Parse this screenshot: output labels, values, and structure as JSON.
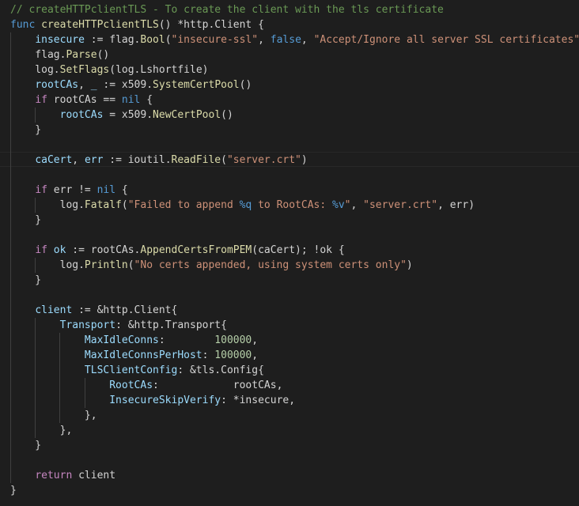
{
  "editor": {
    "theme_colors": {
      "background": "#1e1e1e",
      "comment": "#6a9955",
      "keyword": "#569cd6",
      "control": "#c586c0",
      "function": "#dcdcaa",
      "string": "#ce9178",
      "variable": "#9cdcfe",
      "number": "#b5cea8",
      "plain": "#d4d4d4"
    },
    "lines": [
      [
        [
          "com",
          "// createHTTPclientTLS - To create the client with the tls certificate"
        ]
      ],
      [
        [
          "kw",
          "func"
        ],
        [
          "pl",
          " "
        ],
        [
          "fn",
          "createHTTPclientTLS"
        ],
        [
          "pl",
          "() *http.Client {"
        ]
      ],
      [
        [
          "pl",
          "    "
        ],
        [
          "var",
          "insecure"
        ],
        [
          "pl",
          " := flag."
        ],
        [
          "fn",
          "Bool"
        ],
        [
          "pl",
          "("
        ],
        [
          "str",
          "\"insecure-ssl\""
        ],
        [
          "pl",
          ", "
        ],
        [
          "kw",
          "false"
        ],
        [
          "pl",
          ", "
        ],
        [
          "str",
          "\"Accept/Ignore all server SSL certificates\""
        ],
        [
          "pl",
          ")"
        ]
      ],
      [
        [
          "pl",
          "    flag."
        ],
        [
          "fn",
          "Parse"
        ],
        [
          "pl",
          "()"
        ]
      ],
      [
        [
          "pl",
          "    log."
        ],
        [
          "fn",
          "SetFlags"
        ],
        [
          "pl",
          "(log.Lshortfile)"
        ]
      ],
      [
        [
          "pl",
          "    "
        ],
        [
          "var",
          "rootCAs"
        ],
        [
          "pl",
          ", "
        ],
        [
          "var",
          "_"
        ],
        [
          "pl",
          " := x509."
        ],
        [
          "fn",
          "SystemCertPool"
        ],
        [
          "pl",
          "()"
        ]
      ],
      [
        [
          "pl",
          "    "
        ],
        [
          "ctl",
          "if"
        ],
        [
          "pl",
          " rootCAs == "
        ],
        [
          "kw",
          "nil"
        ],
        [
          "pl",
          " {"
        ]
      ],
      [
        [
          "pl",
          "        "
        ],
        [
          "var",
          "rootCAs"
        ],
        [
          "pl",
          " = x509."
        ],
        [
          "fn",
          "NewCertPool"
        ],
        [
          "pl",
          "()"
        ]
      ],
      [
        [
          "pl",
          "    }"
        ]
      ],
      [
        [
          "pl",
          ""
        ]
      ],
      [
        [
          "pl",
          "    "
        ],
        [
          "var",
          "caCert"
        ],
        [
          "pl",
          ", "
        ],
        [
          "var",
          "err"
        ],
        [
          "pl",
          " := ioutil."
        ],
        [
          "fn",
          "ReadFile"
        ],
        [
          "pl",
          "("
        ],
        [
          "str",
          "\"server.crt\""
        ],
        [
          "pl",
          ")"
        ]
      ],
      [
        [
          "pl",
          ""
        ]
      ],
      [
        [
          "pl",
          "    "
        ],
        [
          "ctl",
          "if"
        ],
        [
          "pl",
          " err != "
        ],
        [
          "kw",
          "nil"
        ],
        [
          "pl",
          " {"
        ]
      ],
      [
        [
          "pl",
          "        log."
        ],
        [
          "fn",
          "Fatalf"
        ],
        [
          "pl",
          "("
        ],
        [
          "str",
          "\"Failed to append "
        ],
        [
          "kw",
          "%q"
        ],
        [
          "str",
          " to RootCAs: "
        ],
        [
          "kw",
          "%v"
        ],
        [
          "str",
          "\""
        ],
        [
          "pl",
          ", "
        ],
        [
          "str",
          "\"server.crt\""
        ],
        [
          "pl",
          ", err)"
        ]
      ],
      [
        [
          "pl",
          "    }"
        ]
      ],
      [
        [
          "pl",
          ""
        ]
      ],
      [
        [
          "pl",
          "    "
        ],
        [
          "ctl",
          "if"
        ],
        [
          "pl",
          " "
        ],
        [
          "var",
          "ok"
        ],
        [
          "pl",
          " := rootCAs."
        ],
        [
          "fn",
          "AppendCertsFromPEM"
        ],
        [
          "pl",
          "(caCert); !ok {"
        ]
      ],
      [
        [
          "pl",
          "        log."
        ],
        [
          "fn",
          "Println"
        ],
        [
          "pl",
          "("
        ],
        [
          "str",
          "\"No certs appended, using system certs only\""
        ],
        [
          "pl",
          ")"
        ]
      ],
      [
        [
          "pl",
          "    }"
        ]
      ],
      [
        [
          "pl",
          ""
        ]
      ],
      [
        [
          "pl",
          "    "
        ],
        [
          "var",
          "client"
        ],
        [
          "pl",
          " := &http.Client{"
        ]
      ],
      [
        [
          "pl",
          "        "
        ],
        [
          "var",
          "Transport"
        ],
        [
          "pl",
          ": &http.Transport{"
        ]
      ],
      [
        [
          "pl",
          "            "
        ],
        [
          "var",
          "MaxIdleConns"
        ],
        [
          "pl",
          ":        "
        ],
        [
          "num",
          "100000"
        ],
        [
          "pl",
          ","
        ]
      ],
      [
        [
          "pl",
          "            "
        ],
        [
          "var",
          "MaxIdleConnsPerHost"
        ],
        [
          "pl",
          ": "
        ],
        [
          "num",
          "100000"
        ],
        [
          "pl",
          ","
        ]
      ],
      [
        [
          "pl",
          "            "
        ],
        [
          "var",
          "TLSClientConfig"
        ],
        [
          "pl",
          ": &tls.Config{"
        ]
      ],
      [
        [
          "pl",
          "                "
        ],
        [
          "var",
          "RootCAs"
        ],
        [
          "pl",
          ":            rootCAs,"
        ]
      ],
      [
        [
          "pl",
          "                "
        ],
        [
          "var",
          "InsecureSkipVerify"
        ],
        [
          "pl",
          ": *insecure,"
        ]
      ],
      [
        [
          "pl",
          "            },"
        ]
      ],
      [
        [
          "pl",
          "        },"
        ]
      ],
      [
        [
          "pl",
          "    }"
        ]
      ],
      [
        [
          "pl",
          ""
        ]
      ],
      [
        [
          "pl",
          "    "
        ],
        [
          "ctl",
          "return"
        ],
        [
          "pl",
          " client"
        ]
      ],
      [
        [
          "pl",
          "}"
        ]
      ]
    ]
  }
}
